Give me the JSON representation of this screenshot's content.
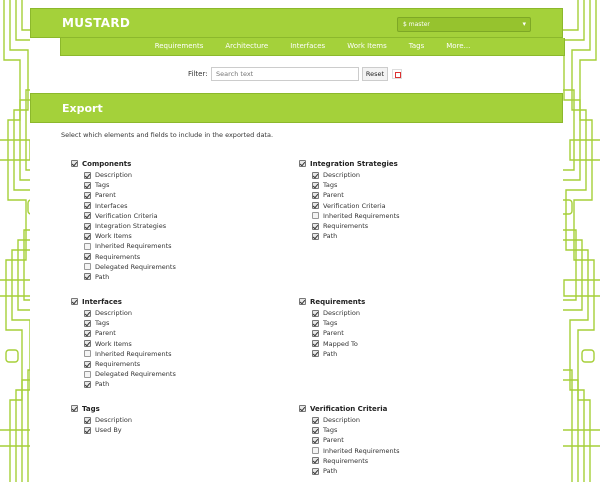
{
  "app": {
    "brand": "MUSTARD",
    "branch": "$ master",
    "branch_caret": "▾"
  },
  "nav": [
    "Requirements",
    "Architecture",
    "Interfaces",
    "Work Items",
    "Tags",
    "More..."
  ],
  "filter": {
    "label": "Filter:",
    "placeholder": "Search text",
    "value": "",
    "reset_label": "Reset"
  },
  "section": {
    "title": "Export",
    "intro": "Select which elements and fields to include in the exported data."
  },
  "groups": [
    {
      "label": "Components",
      "checked": true,
      "fields": [
        {
          "label": "Description",
          "checked": true
        },
        {
          "label": "Tags",
          "checked": true
        },
        {
          "label": "Parent",
          "checked": true
        },
        {
          "label": "Interfaces",
          "checked": true
        },
        {
          "label": "Verification Criteria",
          "checked": true
        },
        {
          "label": "Integration Strategies",
          "checked": true
        },
        {
          "label": "Work Items",
          "checked": true
        },
        {
          "label": "Inherited Requirements",
          "checked": false
        },
        {
          "label": "Requirements",
          "checked": true
        },
        {
          "label": "Delegated Requirements",
          "checked": false
        },
        {
          "label": "Path",
          "checked": true
        }
      ]
    },
    {
      "label": "Integration Strategies",
      "checked": true,
      "fields": [
        {
          "label": "Description",
          "checked": true
        },
        {
          "label": "Tags",
          "checked": true
        },
        {
          "label": "Parent",
          "checked": true
        },
        {
          "label": "Verification Criteria",
          "checked": true
        },
        {
          "label": "Inherited Requirements",
          "checked": false
        },
        {
          "label": "Requirements",
          "checked": true
        },
        {
          "label": "Path",
          "checked": true
        }
      ]
    },
    {
      "label": "Interfaces",
      "checked": true,
      "fields": [
        {
          "label": "Description",
          "checked": true
        },
        {
          "label": "Tags",
          "checked": true
        },
        {
          "label": "Parent",
          "checked": true
        },
        {
          "label": "Work Items",
          "checked": true
        },
        {
          "label": "Inherited Requirements",
          "checked": false
        },
        {
          "label": "Requirements",
          "checked": true
        },
        {
          "label": "Delegated Requirements",
          "checked": false
        },
        {
          "label": "Path",
          "checked": true
        }
      ]
    },
    {
      "label": "Requirements",
      "checked": true,
      "fields": [
        {
          "label": "Description",
          "checked": true
        },
        {
          "label": "Tags",
          "checked": true
        },
        {
          "label": "Parent",
          "checked": true
        },
        {
          "label": "Mapped To",
          "checked": true
        },
        {
          "label": "Path",
          "checked": true
        }
      ]
    },
    {
      "label": "Tags",
      "checked": true,
      "fields": [
        {
          "label": "Description",
          "checked": true
        },
        {
          "label": "Used By",
          "checked": true
        }
      ]
    },
    {
      "label": "Verification Criteria",
      "checked": true,
      "fields": [
        {
          "label": "Description",
          "checked": true
        },
        {
          "label": "Tags",
          "checked": true
        },
        {
          "label": "Parent",
          "checked": true
        },
        {
          "label": "Inherited Requirements",
          "checked": false
        },
        {
          "label": "Requirements",
          "checked": true
        },
        {
          "label": "Path",
          "checked": true
        }
      ]
    }
  ],
  "colors": {
    "accent": "#a4d13a",
    "pattern": "#9fcb2f"
  }
}
